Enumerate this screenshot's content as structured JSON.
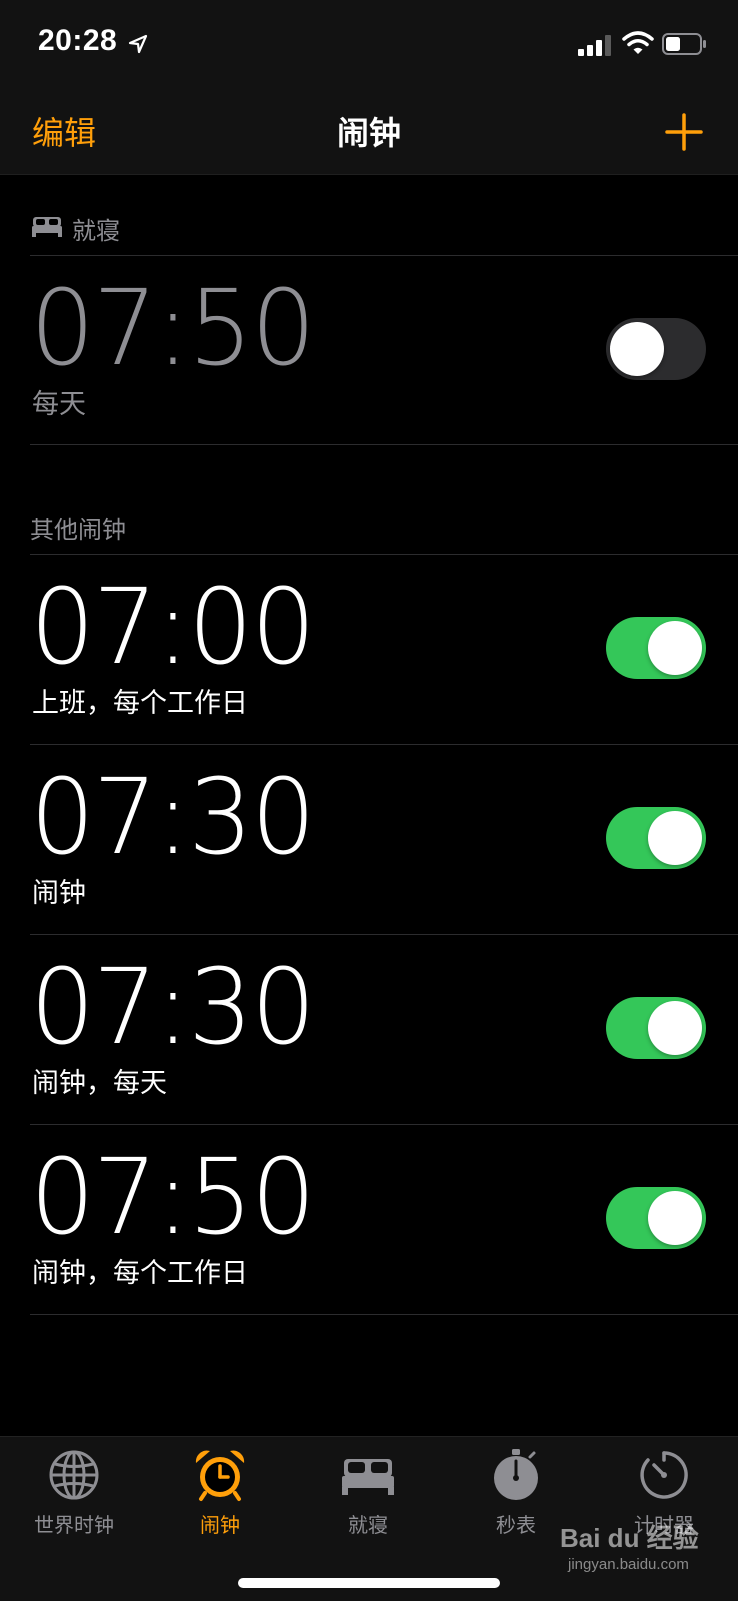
{
  "status_bar": {
    "time": "20:28"
  },
  "nav": {
    "edit_label": "编辑",
    "title": "闹钟"
  },
  "sections": {
    "bedtime_header": "就寝",
    "other_header": "其他闹钟"
  },
  "bedtime_alarm": {
    "time": "07:50",
    "label": "每天",
    "enabled": false
  },
  "alarms": [
    {
      "time": "07:00",
      "label": "上班，每个工作日",
      "enabled": true
    },
    {
      "time": "07:30",
      "label": "闹钟",
      "enabled": true
    },
    {
      "time": "07:30",
      "label": "闹钟，每天",
      "enabled": true
    },
    {
      "time": "07:50",
      "label": "闹钟，每个工作日",
      "enabled": true
    }
  ],
  "tabs": [
    {
      "label": "世界时钟",
      "icon": "globe-icon",
      "active": false
    },
    {
      "label": "闹钟",
      "icon": "alarm-clock-icon",
      "active": true
    },
    {
      "label": "就寝",
      "icon": "bed-icon",
      "active": false
    },
    {
      "label": "秒表",
      "icon": "stopwatch-icon",
      "active": false
    },
    {
      "label": "计时器",
      "icon": "timer-icon",
      "active": false
    }
  ],
  "watermark": {
    "brand": "Bai du 经验",
    "url": "jingyan.baidu.com"
  },
  "colors": {
    "accent": "#ff9f0a",
    "toggle_on": "#34c759",
    "toggle_off": "#2c2c2e",
    "secondary_text": "#8e8e93"
  }
}
